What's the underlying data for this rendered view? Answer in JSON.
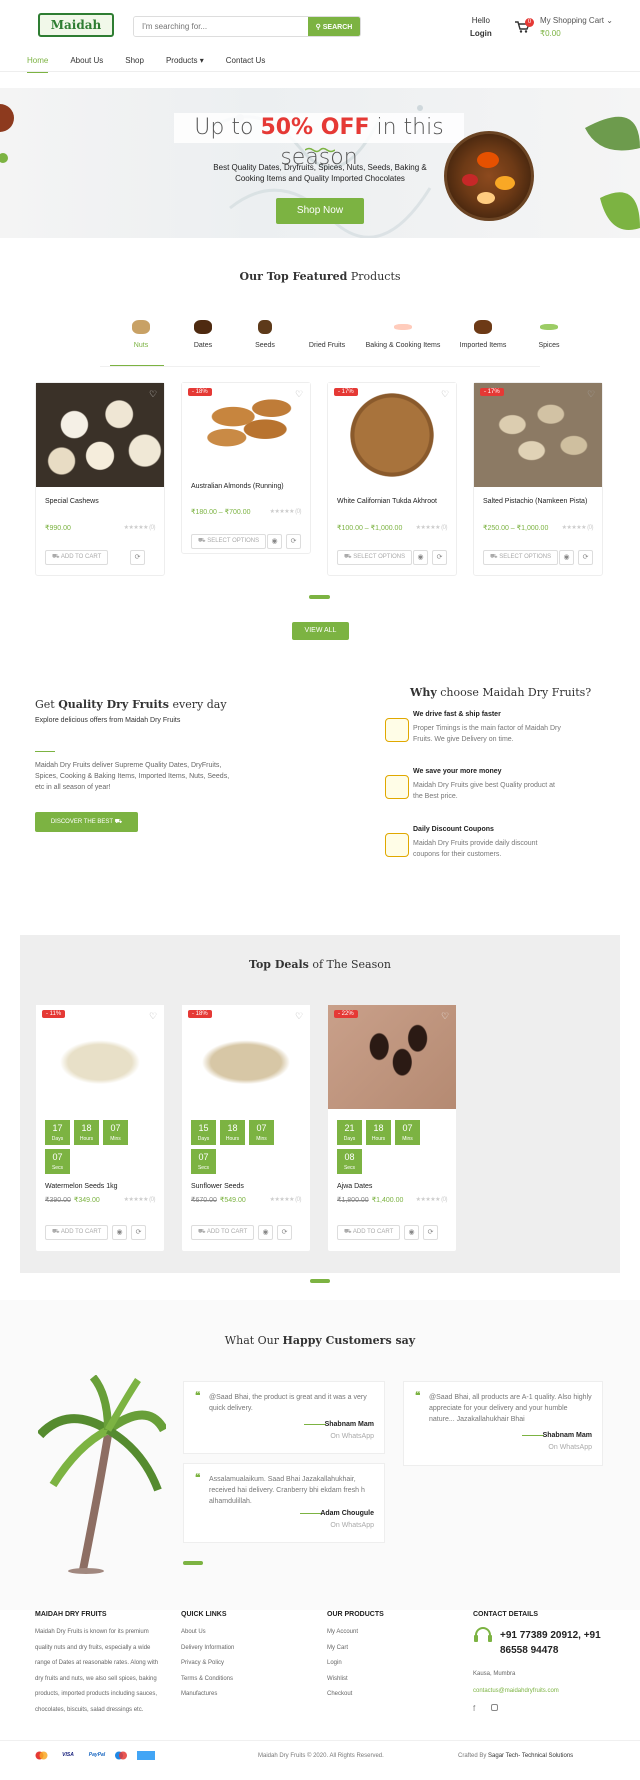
{
  "header": {
    "logo_text": "Maidah",
    "search_placeholder": "I'm searching for...",
    "search_button": "SEARCH",
    "hello": "Hello",
    "login": "Login",
    "cart_count": "0",
    "cart_label": "My Shopping Cart",
    "cart_amount": "₹0.00"
  },
  "nav": [
    "Home",
    "About Us",
    "Shop",
    "Products",
    "Contact Us"
  ],
  "hero": {
    "title_pre": "Up to ",
    "title_hl": "50% OFF",
    "title_post": " in this season",
    "subtitle": "Best Quality Dates, Dryfruits, Spices, Nuts, Seeds, Baking & Cooking Items and Quality Imported Chocolates",
    "button": "Shop Now"
  },
  "featured": {
    "title_b": "Our Top Featured",
    "title_r": " Products"
  },
  "categories": [
    "Nuts",
    "Dates",
    "Seeds",
    "Dried Fruits",
    "Baking & Cooking Items",
    "Imported Items",
    "Spices"
  ],
  "products": [
    {
      "name": "Special Cashews",
      "badge": "",
      "price": "₹990.00",
      "rating": "(0)",
      "btn": "ADD TO CART"
    },
    {
      "name": "Australian Almonds (Running)",
      "badge": "- 18%",
      "price": "₹180.00 – ₹700.00",
      "rating": "(0)",
      "btn": "SELECT OPTIONS"
    },
    {
      "name": "White Californian Tukda Akhroot",
      "badge": "- 17%",
      "price": "₹100.00 – ₹1,000.00",
      "rating": "(0)",
      "btn": "SELECT OPTIONS"
    },
    {
      "name": "Salted Pistachio (Namkeen Pista)",
      "badge": "- 17%",
      "price": "₹250.00 – ₹1,000.00",
      "rating": "(0)",
      "btn": "SELECT OPTIONS"
    }
  ],
  "view_all": "VIEW ALL",
  "promo": {
    "h_pre": "Get ",
    "h_b": "Quality Dry Fruits",
    "h_post": " every day",
    "sub": "Explore delicious offers from Maidah Dry Fruits",
    "para": "Maidah Dry Fruits deliver Supreme Quality Dates, DryFruits, Spices, Cooking & Baking Items, Imported Items, Nuts, Seeds, etc in all season of year!",
    "button": "DISCOVER THE BEST"
  },
  "why": {
    "h_b": "Why",
    "h_r": " choose Maidah Dry Fruits?",
    "items": [
      {
        "t": "We drive fast & ship faster",
        "d": "Proper Timings is the main factor of Maidah Dry Fruits. We give Delivery on time."
      },
      {
        "t": "We save your more money",
        "d": "Maidah Dry Fruits give best Quality product at the Best price."
      },
      {
        "t": "Daily Discount Coupons",
        "d": "Maidah Dry Fruits provide daily discount coupons for their customers."
      }
    ]
  },
  "deals": {
    "title_b": "Top Deals",
    "title_r": " of The Season",
    "items": [
      {
        "name": "Watermelon Seeds 1kg",
        "badge": "- 11%",
        "old": "₹390.00",
        "new": "₹349.00",
        "days": "17",
        "hours": "18",
        "mins": "07",
        "secs": "07",
        "rating": "(0)",
        "btn": "ADD TO CART"
      },
      {
        "name": "Sunflower Seeds",
        "badge": "- 18%",
        "old": "₹670.00",
        "new": "₹549.00",
        "days": "15",
        "hours": "18",
        "mins": "07",
        "secs": "07",
        "rating": "(0)",
        "btn": "ADD TO CART"
      },
      {
        "name": "Ajwa Dates",
        "badge": "- 22%",
        "old": "₹1,800.00",
        "new": "₹1,400.00",
        "days": "21",
        "hours": "18",
        "mins": "07",
        "secs": "08",
        "rating": "(0)",
        "btn": "ADD TO CART"
      }
    ],
    "units": [
      "Days",
      "Hours",
      "Mins",
      "Secs"
    ]
  },
  "testimonials": {
    "title_r": "What Our ",
    "title_b": "Happy Customers say",
    "items": [
      {
        "text": "@Saad Bhai, the product is great and it was a very quick delivery.",
        "name": "Shabnam Mam",
        "src": "On WhatsApp"
      },
      {
        "text": "@Saad Bhai, all products are A-1 quality. Also highly appreciate for your delivery and your humble nature... Jazakallahukhair Bhai",
        "name": "Shabnam Mam",
        "src": "On WhatsApp"
      },
      {
        "text": "Assalamualaikum. Saad Bhai Jazakallahukhair, received hai delivery. Cranberry bhi ekdam fresh h alhamdulillah.",
        "name": "Adam Chougule",
        "src": "On WhatsApp"
      }
    ]
  },
  "footer": {
    "c1_h": "MAIDAH DRY FRUITS",
    "c1_p": "Maidah Dry Fruits is known for its premium quality nuts and dry fruits, especially a wide range of Dates at reasonable rates. Along with dry fruits and nuts, we also sell spices, baking products, imported products including sauces, chocolates, biscuits, salad dressings etc.",
    "c2_h": "QUICK LINKS",
    "c2": [
      "About Us",
      "Delivery Information",
      "Privacy & Policy",
      "Terms & Conditions",
      "Manufactures"
    ],
    "c3_h": "OUR PRODUCTS",
    "c3": [
      "My Account",
      "My Cart",
      "Login",
      "Wishlist",
      "Checkout"
    ],
    "c4_h": "CONTACT DETAILS",
    "phone": "+91 77389 20912, +91 86558 94478",
    "city": "Kausa, Mumbra",
    "email": "contactus@maidahdryfruits.com",
    "copy": "Maidah Dry Fruits © 2020. All Rights Reserved.",
    "crafted_pre": "Crafted By ",
    "crafted_by": "Sagar Tech- Technical Solutions",
    "pay": [
      "VISA",
      "PayPal"
    ]
  },
  "colors": {
    "accent": "#7cb342",
    "sale": "#e53935"
  }
}
